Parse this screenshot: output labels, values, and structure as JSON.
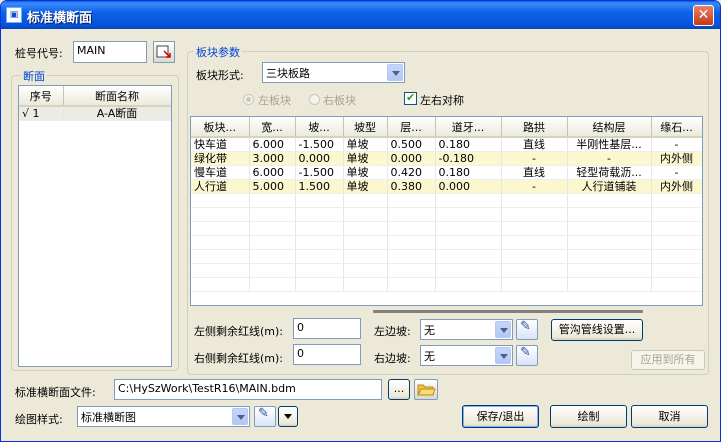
{
  "window": {
    "title": "标准横断面",
    "app_icon": "app-icon",
    "close_icon": "close-icon"
  },
  "station": {
    "label": "桩号代号:",
    "value": "MAIN"
  },
  "sections": {
    "title": "断面",
    "columns": [
      "序号",
      "断面名称"
    ],
    "rows": [
      {
        "mark": "√",
        "index": "1",
        "name": "A-A断面"
      }
    ]
  },
  "block_params": {
    "title": "板块参数",
    "form_label": "板块形式:",
    "form_value": "三块板路",
    "left_block": "左板块",
    "right_block": "右板块",
    "symmetric": "左右对称"
  },
  "blocks_table": {
    "columns": [
      "板块...",
      "宽...",
      "坡...",
      "坡型",
      "层...",
      "道牙...",
      "路拱",
      "结构层",
      "缘石..."
    ],
    "rows": [
      {
        "hl": false,
        "cells": [
          "快车道",
          "6.000",
          "-1.500",
          "单坡",
          "0.500",
          "0.180",
          "直线",
          "半刚性基层...",
          "-"
        ]
      },
      {
        "hl": true,
        "cells": [
          "绿化带",
          "3.000",
          "0.000",
          "单坡",
          "0.000",
          "-0.180",
          "-",
          "-",
          "内外侧"
        ]
      },
      {
        "hl": false,
        "cells": [
          "慢车道",
          "6.000",
          "-1.500",
          "单坡",
          "0.420",
          "0.180",
          "直线",
          "轻型荷载沥...",
          "-"
        ]
      },
      {
        "hl": true,
        "cells": [
          "人行道",
          "5.000",
          "1.500",
          "单坡",
          "0.380",
          "0.000",
          "-",
          "人行道铺装",
          "内外侧"
        ]
      }
    ]
  },
  "redline": {
    "left_label": "左侧剩余红线(m):",
    "left_value": "0",
    "right_label": "右侧剩余红线(m):",
    "right_value": "0"
  },
  "slopes": {
    "left_label": "左边坡:",
    "left_value": "无",
    "right_label": "右边坡:",
    "right_value": "无"
  },
  "buttons": {
    "pipe": "管沟管线设置...",
    "apply_all": "应用到所有",
    "browse": "...",
    "save_exit": "保存/退出",
    "draw": "绘制",
    "cancel": "取消"
  },
  "file": {
    "label": "标准横断面文件:",
    "path": "C:\\HySzWork\\TestR16\\MAIN.bdm"
  },
  "style": {
    "label": "绘图样式:",
    "value": "标准横断图"
  }
}
